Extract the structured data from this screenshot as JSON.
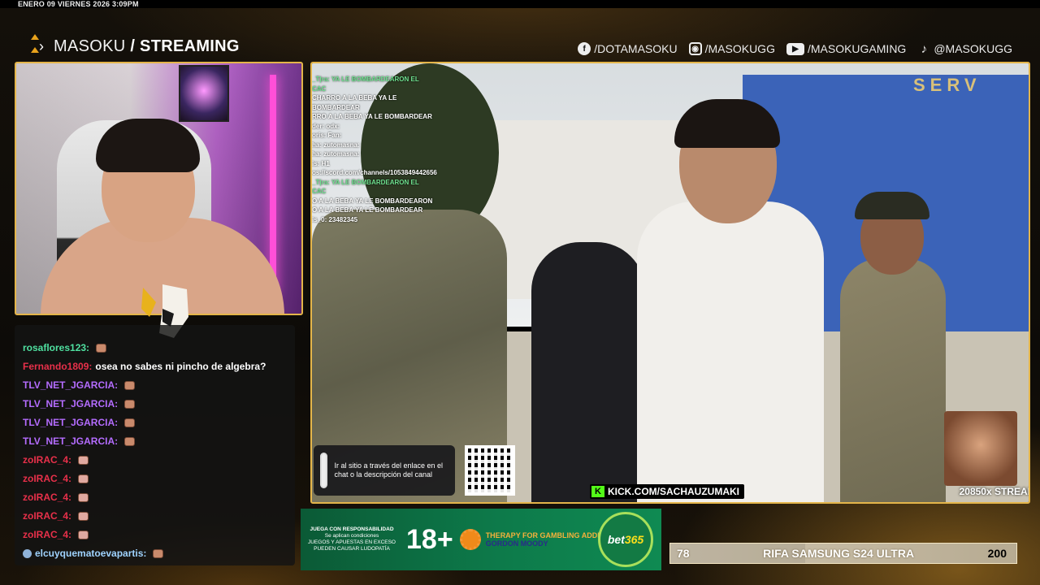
{
  "datetime": "ENERO 09 VIERNES 2026 3:09PM",
  "brand": {
    "part1": "MASOKU",
    "part2": "/ STREAMING"
  },
  "socials": [
    {
      "icon": "facebook-icon",
      "label": "/DOTAMASOKU"
    },
    {
      "icon": "instagram-icon",
      "label": "/MASOKUGG"
    },
    {
      "icon": "youtube-icon",
      "label": "/MASOKUGAMING"
    },
    {
      "icon": "tiktok-icon",
      "label": "@MASOKUGG"
    }
  ],
  "chat": [
    {
      "user": "rosaflores123:",
      "color": "#4fe0a0",
      "msg": "",
      "emote": "emote"
    },
    {
      "user": "Fernando1809:",
      "color": "#e8304a",
      "msg": "osea no sabes ni pincho de algebra?",
      "emote": ""
    },
    {
      "user": "TLV_NET_JGARCIA:",
      "color": "#b46cff",
      "msg": "",
      "emote": "emote"
    },
    {
      "user": "TLV_NET_JGARCIA:",
      "color": "#b46cff",
      "msg": "",
      "emote": "emote"
    },
    {
      "user": "TLV_NET_JGARCIA:",
      "color": "#b46cff",
      "msg": "",
      "emote": "emote"
    },
    {
      "user": "TLV_NET_JGARCIA:",
      "color": "#b46cff",
      "msg": "",
      "emote": "emote"
    },
    {
      "user": "zoIRAC_4:",
      "color": "#e8304a",
      "msg": "",
      "emote": "emote-shock"
    },
    {
      "user": "zoIRAC_4:",
      "color": "#e8304a",
      "msg": "",
      "emote": "emote-shock"
    },
    {
      "user": "zoIRAC_4:",
      "color": "#e8304a",
      "msg": "",
      "emote": "emote-shock"
    },
    {
      "user": "zoIRAC_4:",
      "color": "#e8304a",
      "msg": "",
      "emote": "emote-shock"
    },
    {
      "user": "zoIRAC_4:",
      "color": "#e8304a",
      "msg": "",
      "emote": "emote-shock"
    },
    {
      "user": "elcuyquematoevapartis:",
      "color": "#9fd3ff",
      "msg": "",
      "emote": "emote",
      "badge": true
    }
  ],
  "stream_overlay_chat": [
    "_T|ra: YA LE BOMBARDEARON EL CAC",
    "CHARRO A LA BEBA YA LE BOMBARDEAR",
    "RRO A LA BEBA YA LE BOMBARDEAR",
    "der: odx:",
    "oris: Fan:",
    "ha: zutomasna:",
    "ha: zutomasna:",
    "is: H1",
    "",
    "os://scord.com/channels/1053849442656",
    "_T|ra: YA LE BOMBARDEARON EL CAC",
    "O A LA BEBA YA LE BOMBARDEARON",
    "O A LA BEBA YA LE BOMBARDEAR",
    "is_0: 23482345"
  ],
  "qr_prompt": "Ir al sitio a través del enlace en el chat o la descripción del canal",
  "kick_url": "KICK.COM/SACHAUZUMAKI",
  "building_sign": "SERV",
  "meme_count": "20850x STREAI",
  "ad": {
    "left_heading": "JUEGA CON RESPONSABILIDAD",
    "left_sub": "Se aplican condiciones",
    "left_body": "JUEGOS Y APUESTAS EN EXCESO PUEDEN CAUSAR LUDOPATÍA",
    "age": "18+",
    "therapy": "THERAPY FOR GAMBLING ADDICTION",
    "gordon": "GORDON MOODY",
    "bet_a": "bet",
    "bet_b": "365"
  },
  "raffle": {
    "current": "78",
    "label": "RIFA SAMSUNG S24 ULTRA",
    "target": "200",
    "progress": 0.39
  },
  "colors": {
    "accent": "#e4b54a",
    "kick_green": "#53fc18"
  }
}
